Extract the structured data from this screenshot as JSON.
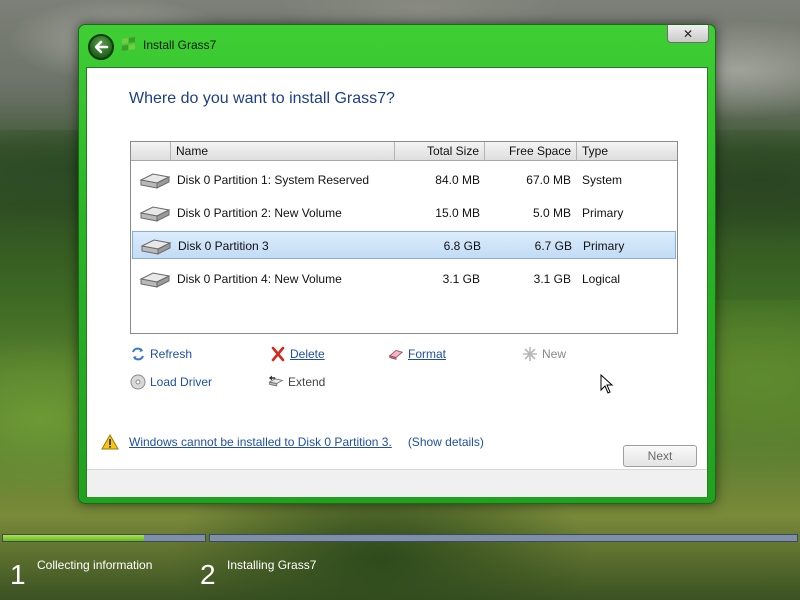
{
  "window": {
    "title": "Install Grass7",
    "close_label": "✕"
  },
  "page": {
    "heading": "Where do you want to install Grass7?"
  },
  "table": {
    "columns": [
      "Name",
      "Total Size",
      "Free Space",
      "Type"
    ],
    "rows": [
      {
        "name": "Disk 0 Partition 1: System Reserved",
        "total": "84.0 MB",
        "free": "67.0 MB",
        "type": "System",
        "selected": false
      },
      {
        "name": "Disk 0 Partition 2: New Volume",
        "total": "15.0 MB",
        "free": "5.0 MB",
        "type": "Primary",
        "selected": false
      },
      {
        "name": "Disk 0 Partition 3",
        "total": "6.8 GB",
        "free": "6.7 GB",
        "type": "Primary",
        "selected": true
      },
      {
        "name": "Disk 0 Partition 4: New Volume",
        "total": "3.1 GB",
        "free": "3.1 GB",
        "type": "Logical",
        "selected": false
      }
    ]
  },
  "actions": {
    "refresh": "Refresh",
    "delete": "Delete",
    "format": "Format",
    "new": "New",
    "load_driver": "Load Driver",
    "extend": "Extend"
  },
  "warning": {
    "message": "Windows cannot be installed to Disk 0 Partition 3.",
    "details": "(Show details)"
  },
  "buttons": {
    "next": "Next"
  },
  "progress": {
    "step1_fraction": 0.7,
    "steps": [
      {
        "number": "1",
        "label": "Collecting information"
      },
      {
        "number": "2",
        "label": "Installing Grass7"
      }
    ]
  },
  "colors": {
    "window_frame": "#2bb427",
    "heading": "#1e3f87",
    "link": "#1f4fa8",
    "selection": "#c2dcf5"
  }
}
